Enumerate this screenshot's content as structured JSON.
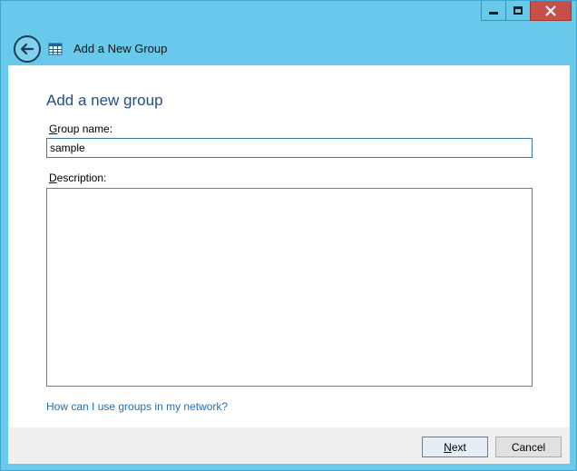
{
  "window": {
    "title": "Add a New Group",
    "controls": {
      "minimize": "minimize",
      "maximize": "maximize",
      "close": "close"
    },
    "colors": {
      "frame": "#69c9ea",
      "close": "#c7504a",
      "heading": "#1e4e8c",
      "link": "#1e6fb8"
    }
  },
  "header": {
    "back_icon": "back-arrow-icon",
    "app_icon": "group-table-icon"
  },
  "main": {
    "heading": "Add a new group",
    "group_name": {
      "label_access": "G",
      "label_rest": "roup name:",
      "value": "sample"
    },
    "description": {
      "label_access": "D",
      "label_rest": "escription:",
      "value": ""
    },
    "help_link": "How can I use groups in my network?"
  },
  "footer": {
    "next_access": "N",
    "next_rest": "ext",
    "cancel": "Cancel"
  }
}
